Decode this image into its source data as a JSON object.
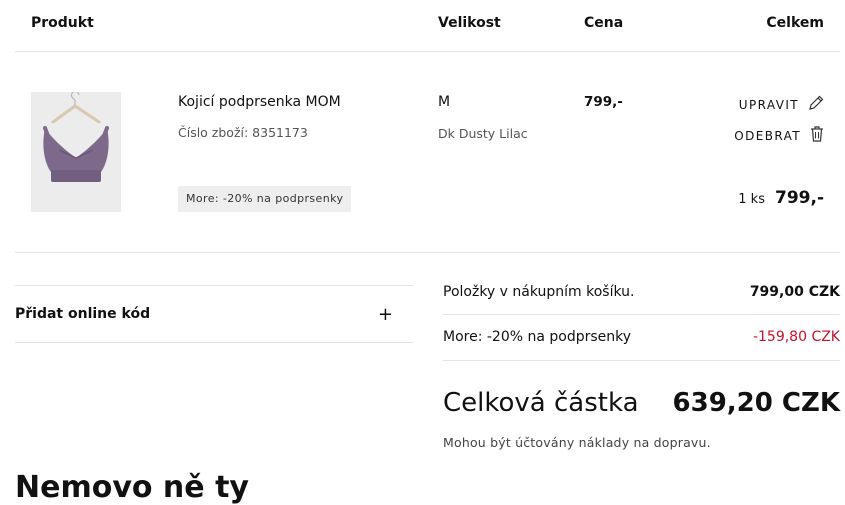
{
  "table_headers": {
    "product": "Produkt",
    "size": "Velikost",
    "price": "Cena",
    "total": "Celkem"
  },
  "item": {
    "name": "Kojicí podprsenka MOM",
    "number": "Číslo zboží: 8351173",
    "promo": "More: -20% na podprsenky",
    "size": "M",
    "color": "Dk Dusty Lilac",
    "price": "799,-",
    "edit_label": "UPRAVIT",
    "remove_label": "ODEBRAT",
    "quantity": "1 ks",
    "line_total": "799,-",
    "image_colors": {
      "background": "#ececec",
      "garment": "#7d6a8a"
    }
  },
  "coupon": {
    "label": "Přidat online kód",
    "expand_icon": "+"
  },
  "summary": {
    "items_label": "Položky v nákupním košíku.",
    "items_value": "799,00 CZK",
    "discount_label": "More: -20% na podprsenky",
    "discount_value": "-159,80 CZK",
    "grand_label": "Celková částka",
    "grand_value": "639,20 CZK",
    "shipping_note": "Mohou být účtovány náklady na dopravu."
  },
  "section_below_partial": "Nemovo ně ty",
  "colors": {
    "discount": "#c8102e",
    "divider": "#e3e3e3",
    "badge_bg": "#eeeeee"
  }
}
